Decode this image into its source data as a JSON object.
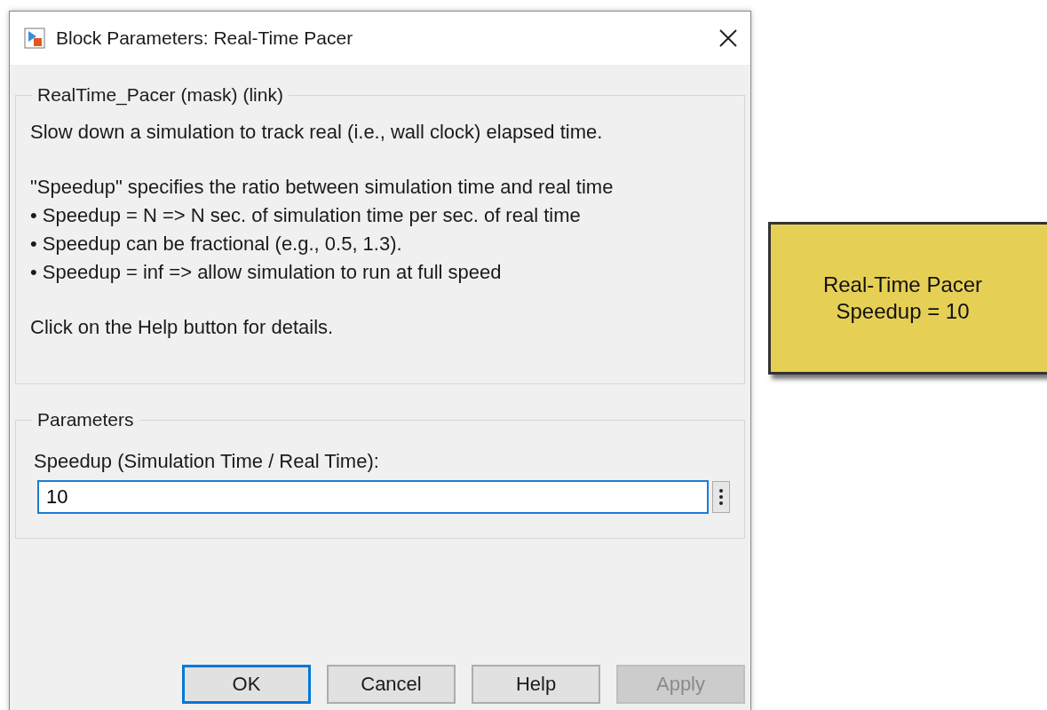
{
  "dialog": {
    "title": "Block Parameters: Real-Time Pacer",
    "description_group": {
      "title": "RealTime_Pacer (mask) (link)",
      "paragraphs": [
        [
          "Slow down a simulation to track real (i.e., wall clock) elapsed time."
        ],
        [
          "\"Speedup\" specifies the ratio between simulation time and real time",
          "• Speedup = N => N sec. of simulation time per sec. of real time",
          "• Speedup can be fractional (e.g., 0.5, 1.3).",
          "• Speedup = inf => allow simulation to run at full speed"
        ],
        [
          "Click on the Help button for details."
        ]
      ]
    },
    "parameters_group": {
      "title": "Parameters",
      "fields": [
        {
          "label": "Speedup (Simulation Time / Real Time):",
          "value": "10"
        }
      ]
    },
    "buttons": [
      {
        "label": "OK",
        "default": true,
        "disabled": false
      },
      {
        "label": "Cancel",
        "default": false,
        "disabled": false
      },
      {
        "label": "Help",
        "default": false,
        "disabled": false
      },
      {
        "label": "Apply",
        "default": false,
        "disabled": true
      }
    ]
  },
  "block": {
    "lines": [
      "Real-Time Pacer",
      "Speedup = 10"
    ]
  }
}
